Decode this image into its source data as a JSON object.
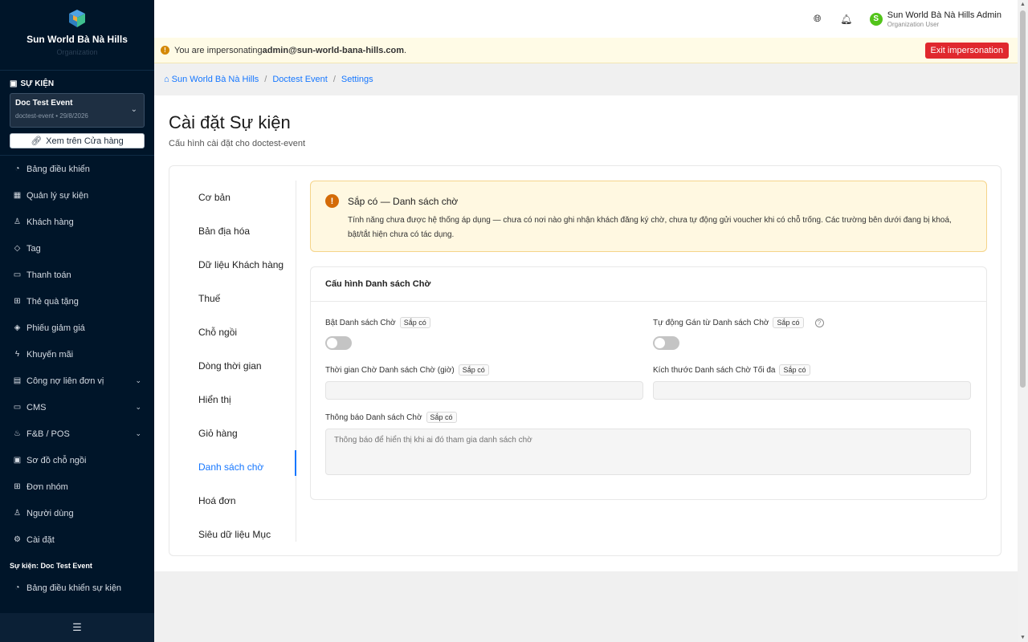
{
  "brand": {
    "name": "Sun World Bà Nà Hills",
    "sub": "Organization"
  },
  "sidebar": {
    "section_label": "SỰ KIỆN",
    "event": {
      "name": "Doc Test Event",
      "meta": "doctest-event • 29/8/2026"
    },
    "store_button": "Xem trên Cửa hàng",
    "items": [
      {
        "label": "Bảng điều khiển",
        "icon": "dashboard-icon"
      },
      {
        "label": "Quản lý sự kiện",
        "icon": "calendar-icon"
      },
      {
        "label": "Khách hàng",
        "icon": "users-icon"
      },
      {
        "label": "Tag",
        "icon": "tag-icon"
      },
      {
        "label": "Thanh toán",
        "icon": "payment-icon"
      },
      {
        "label": "Thẻ quà tặng",
        "icon": "gift-icon"
      },
      {
        "label": "Phiếu giảm giá",
        "icon": "coupon-icon"
      },
      {
        "label": "Khuyến mãi",
        "icon": "promotion-icon"
      },
      {
        "label": "Công nợ liên đơn vị",
        "icon": "debt-icon"
      },
      {
        "label": "CMS",
        "icon": "cms-icon"
      },
      {
        "label": "F&B / POS",
        "icon": "fnb-icon"
      },
      {
        "label": "Sơ đồ chỗ ngồi",
        "icon": "seatmap-icon"
      },
      {
        "label": "Đơn nhóm",
        "icon": "group-order-icon"
      },
      {
        "label": "Người dùng",
        "icon": "user-icon"
      },
      {
        "label": "Cài đặt",
        "icon": "gear-icon"
      }
    ],
    "group_title": "Sự kiện: Doc Test Event",
    "event_items": [
      {
        "label": "Bảng điều khiển sự kiện",
        "icon": "dashboard-icon"
      }
    ]
  },
  "header": {
    "user_name": "Sun World Bà Nà Hills Admin",
    "user_role": "Organization User",
    "avatar_letter": "S"
  },
  "impersonation": {
    "prefix": "You are impersonating ",
    "email": "admin@sun-world-bana-hills.com",
    "suffix": ".",
    "exit_label": "Exit impersonation"
  },
  "breadcrumb": {
    "home": "Sun World Bà Nà Hills",
    "event": "Doctest Event",
    "current": "Settings"
  },
  "page": {
    "title": "Cài đặt Sự kiện",
    "subtitle": "Cấu hình cài đặt cho doctest-event"
  },
  "tabs": [
    "Cơ bản",
    "Bản địa hóa",
    "Dữ liệu Khách hàng",
    "Thuế",
    "Chỗ ngồi",
    "Dòng thời gian",
    "Hiển thị",
    "Giỏ hàng",
    "Danh sách chờ",
    "Hoá đơn",
    "Siêu dữ liệu Mục"
  ],
  "notice": {
    "title": "Sắp có — Danh sách chờ",
    "desc": "Tính năng chưa được hệ thống áp dụng — chưa có nơi nào ghi nhận khách đăng ký chờ, chưa tự động gửi voucher khi có chỗ trống. Các trường bên dưới đang bị khoá, bật/tắt hiện chưa có tác dụng."
  },
  "config": {
    "title": "Cấu hình Danh sách Chờ",
    "soon_label": "Sắp có",
    "enable_label": "Bật Danh sách Chờ",
    "auto_assign_label": "Tự động Gán từ Danh sách Chờ",
    "wait_time_label": "Thời gian Chờ Danh sách Chờ (giờ)",
    "max_size_label": "Kích thước Danh sách Chờ Tối đa",
    "notice_label": "Thông báo Danh sách Chờ",
    "notice_placeholder": "Thông báo để hiển thị khi ai đó tham gia danh sách chờ"
  }
}
